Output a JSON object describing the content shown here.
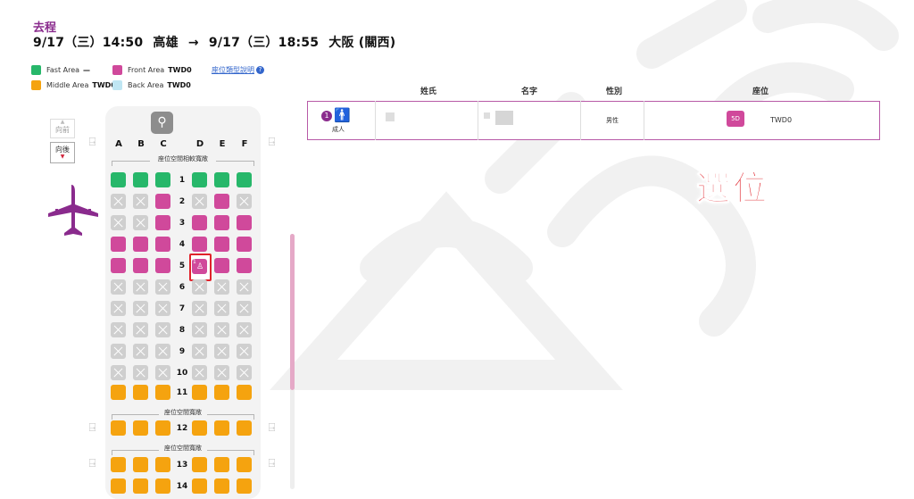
{
  "flight": {
    "direction": "去程",
    "dep_date": "9/17（三）14:50",
    "dep_city": "高雄",
    "arrow": "→",
    "arr_date": "9/17（三）18:55",
    "arr_city": "大阪 (關西)"
  },
  "legend": {
    "items": [
      {
        "label": "Fast Area",
        "price": "—",
        "color": "#27b76a"
      },
      {
        "label": "Front Area",
        "price": "TWD0",
        "color": "#d0499b"
      },
      {
        "label": "Middle Area",
        "price": "TWD0",
        "color": "#f5a30f"
      },
      {
        "label": "Back Area",
        "price": "TWD0",
        "color": "#bfe6f3"
      }
    ],
    "link": "座位類型說明",
    "link_icon": "?"
  },
  "toggles": {
    "forward": "向前",
    "backward": "向後"
  },
  "seatmap": {
    "columns": [
      "A",
      "B",
      "C",
      "D",
      "E",
      "F"
    ],
    "dividers": [
      "座位空間相較寬敞",
      "座位空間寬敞",
      "座位空間寬敞"
    ],
    "rows": [
      {
        "num": "1",
        "seats": [
          "green",
          "green",
          "green",
          "green",
          "green",
          "green"
        ]
      },
      {
        "num": "2",
        "seats": [
          "gray",
          "gray",
          "pink",
          "gray",
          "pink",
          "gray"
        ]
      },
      {
        "num": "3",
        "seats": [
          "gray",
          "gray",
          "pink",
          "pink",
          "pink",
          "pink"
        ]
      },
      {
        "num": "4",
        "seats": [
          "pink",
          "pink",
          "pink",
          "pink",
          "pink",
          "pink"
        ]
      },
      {
        "num": "5",
        "seats": [
          "pink",
          "pink",
          "pink",
          "selected",
          "pink",
          "pink"
        ]
      },
      {
        "num": "6",
        "seats": [
          "gray",
          "gray",
          "gray",
          "gray",
          "gray",
          "gray"
        ]
      },
      {
        "num": "7",
        "seats": [
          "gray",
          "gray",
          "gray",
          "gray",
          "gray",
          "gray"
        ]
      },
      {
        "num": "8",
        "seats": [
          "gray",
          "gray",
          "gray",
          "gray",
          "gray",
          "gray"
        ]
      },
      {
        "num": "9",
        "seats": [
          "gray",
          "gray",
          "gray",
          "gray",
          "gray",
          "gray"
        ]
      },
      {
        "num": "10",
        "seats": [
          "gray",
          "gray",
          "gray",
          "gray",
          "gray",
          "gray"
        ]
      },
      {
        "num": "11",
        "seats": [
          "orange",
          "orange",
          "orange",
          "orange",
          "orange",
          "orange"
        ]
      },
      {
        "num": "12",
        "seats": [
          "orange",
          "orange",
          "orange",
          "orange",
          "orange",
          "orange"
        ]
      },
      {
        "num": "13",
        "seats": [
          "orange",
          "orange",
          "orange",
          "orange",
          "orange",
          "orange"
        ]
      },
      {
        "num": "14",
        "seats": [
          "orange",
          "orange",
          "orange",
          "orange",
          "orange",
          "orange"
        ]
      }
    ],
    "selected_seat_passenger": "1"
  },
  "passenger_table": {
    "headers": [
      "姓氏",
      "名字",
      "性別",
      "座位"
    ],
    "passenger": {
      "number": "1",
      "type": "成人",
      "gender": "男性",
      "seat": "5D",
      "price": "TWD0"
    }
  },
  "annotation": "選位",
  "icons": {
    "restroom": "restroom-icon",
    "exit": "emergency-exit-icon",
    "plane": "airplane-icon",
    "passenger": "person-icon"
  }
}
